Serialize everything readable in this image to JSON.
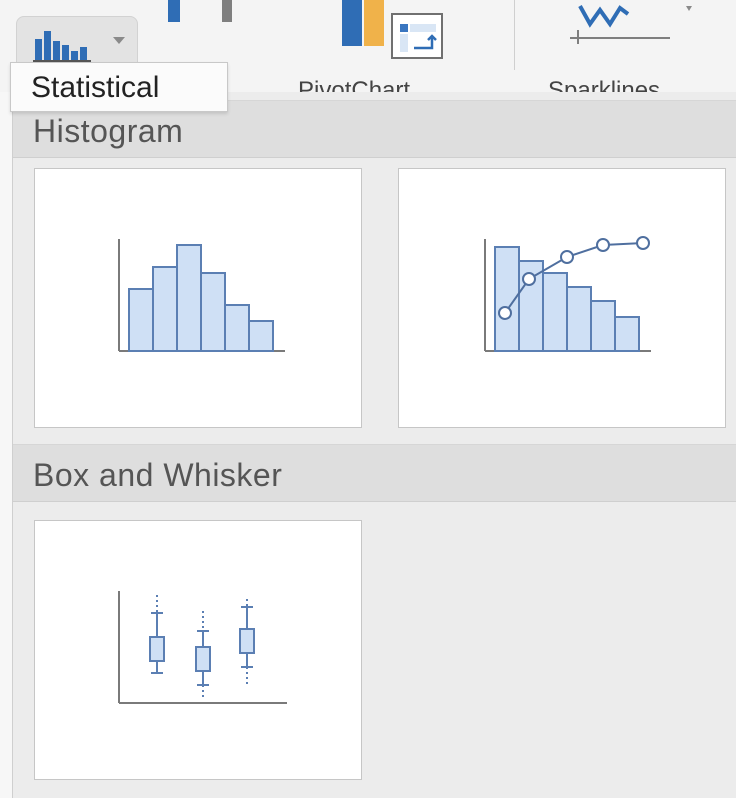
{
  "ribbon": {
    "label_pivot": "PivotChart",
    "label_sparklines": "Sparklines",
    "colors": {
      "chart_blue": "#2f6db5",
      "chart_orange": "#f0b24a",
      "chart_gray": "#7f7f7f"
    }
  },
  "tooltip": {
    "text": "Statistical"
  },
  "sections": {
    "histogram": {
      "title": "Histogram",
      "tiles": [
        {
          "name": "Histogram",
          "icon": "histogram-chart-icon"
        },
        {
          "name": "Pareto",
          "icon": "pareto-chart-icon"
        }
      ]
    },
    "box_whisker": {
      "title": "Box and Whisker",
      "tiles": [
        {
          "name": "Box and Whisker",
          "icon": "box-whisker-chart-icon"
        }
      ]
    }
  },
  "theme": {
    "bar_fill": "#cfe0f5",
    "bar_stroke": "#5b7fb3",
    "axis": "#7a7a7a"
  }
}
